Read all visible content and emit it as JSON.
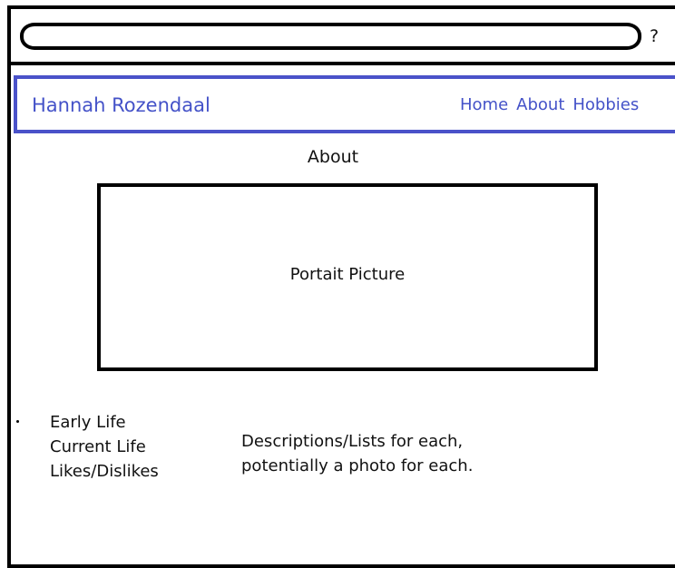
{
  "browser": {
    "help_label": "?"
  },
  "header": {
    "site_title": "Hannah Rozendaal",
    "nav": [
      "Home",
      "About",
      "Hobbies"
    ]
  },
  "main": {
    "page_title": "About",
    "portrait_label": "Portait Picture",
    "sections": [
      "Early Life",
      "Current Life",
      "Likes/Dislikes"
    ],
    "description_lines": [
      "Descriptions/Lists for each,",
      "potentially a photo for each."
    ]
  },
  "colors": {
    "accent": "#4452c8",
    "frame": "#000000"
  }
}
